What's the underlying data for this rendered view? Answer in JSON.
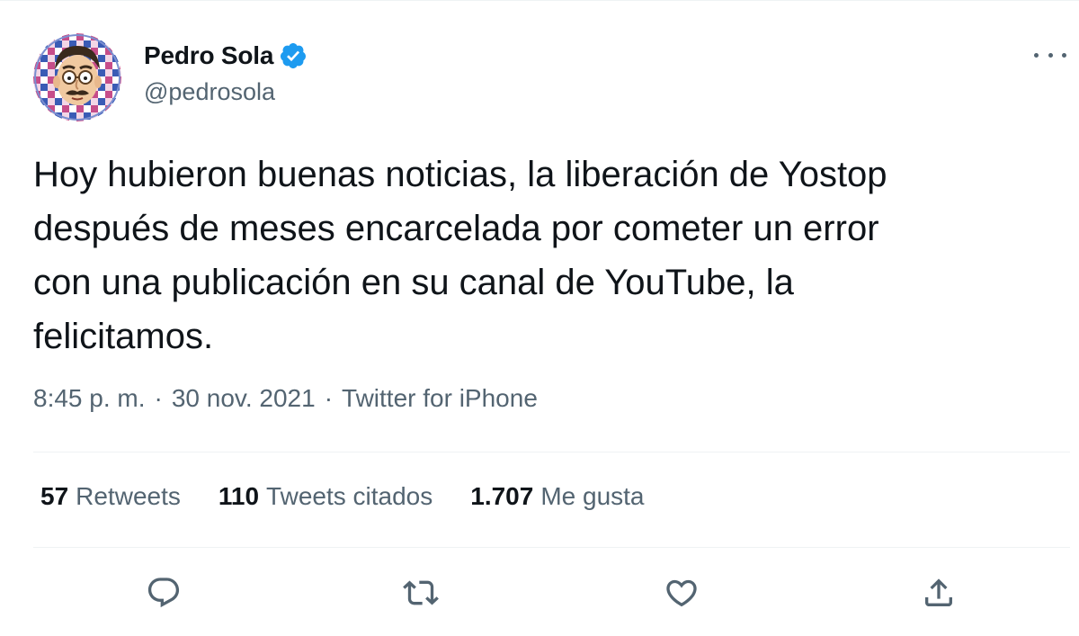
{
  "author": {
    "display_name": "Pedro Sola",
    "handle": "@pedrosola",
    "verified": true,
    "avatar_icon": "cartoon-avatar-with-glasses-and-mustache"
  },
  "tweet": {
    "text": "Hoy hubieron buenas noticias, la liberación de Yostop\ndespués de meses encarcelada por cometer un error\ncon una publicación en su canal de YouTube, la\nfelicitamos.",
    "time": "8:45 p. m.",
    "separator": "·",
    "date": "30 nov. 2021",
    "source": "Twitter for iPhone"
  },
  "stats": [
    {
      "count": "57",
      "label": "Retweets"
    },
    {
      "count": "110",
      "label": "Tweets citados"
    },
    {
      "count": "1.707",
      "label": "Me gusta"
    }
  ],
  "actions": [
    {
      "icon": "reply-icon"
    },
    {
      "icon": "retweet-icon"
    },
    {
      "icon": "like-icon"
    },
    {
      "icon": "share-icon"
    }
  ],
  "colors": {
    "text": "#0f1419",
    "secondary": "#536471",
    "verified": "#1d9bf0",
    "divider": "#eff3f4"
  }
}
